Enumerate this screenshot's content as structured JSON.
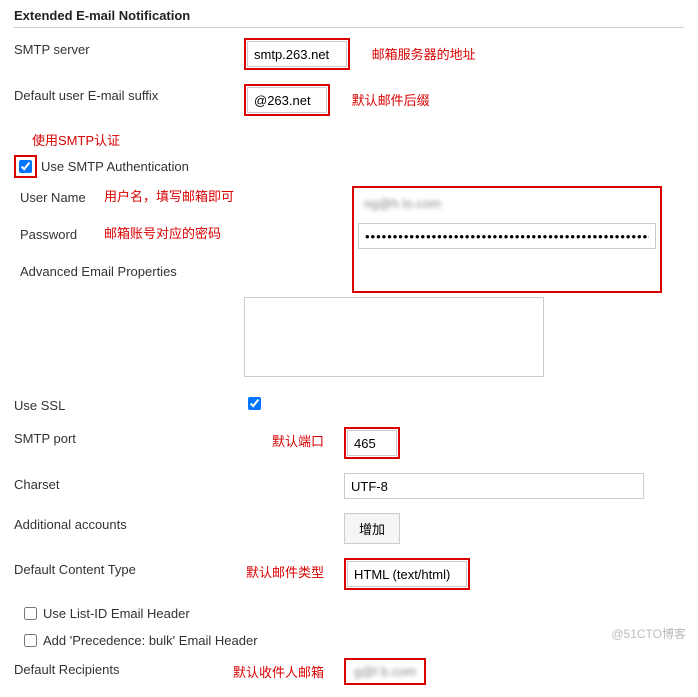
{
  "section_title": "Extended E-mail Notification",
  "labels": {
    "smtp_server": "SMTP server",
    "default_suffix": "Default user E-mail suffix",
    "use_smtp_auth": "Use SMTP Authentication",
    "user_name": "User Name",
    "password": "Password",
    "adv_props": "Advanced Email Properties",
    "use_ssl": "Use SSL",
    "smtp_port": "SMTP port",
    "charset": "Charset",
    "additional_accounts": "Additional accounts",
    "default_content_type": "Default Content Type",
    "use_list_id": "Use List-ID Email Header",
    "add_precedence": "Add 'Precedence: bulk' Email Header",
    "default_recipients": "Default Recipients"
  },
  "values": {
    "smtp_server": "smtp.263.net",
    "default_suffix": "@263.net",
    "use_smtp_auth_checked": true,
    "user_name": "ng@h     lo.com",
    "password": "••••••••••••••••••••••••••••••••••••••••••••••••••••••••",
    "adv_props": "",
    "use_ssl_checked": true,
    "smtp_port": "465",
    "charset": "UTF-8",
    "default_content_type": "HTML (text/html)",
    "use_list_id_checked": false,
    "add_precedence_checked": false,
    "default_recipients": "g@l          b.com"
  },
  "buttons": {
    "add": "增加"
  },
  "annotations": {
    "smtp_server": "邮箱服务器的地址",
    "default_suffix": "默认邮件后缀",
    "use_smtp_auth": "使用SMTP认证",
    "user_name": "用户名，填写邮箱即可",
    "password": "邮箱账号对应的密码",
    "smtp_port": "默认端口",
    "default_content_type": "默认邮件类型",
    "default_recipients": "默认收件人邮箱"
  },
  "watermark": "@51CTO博客"
}
